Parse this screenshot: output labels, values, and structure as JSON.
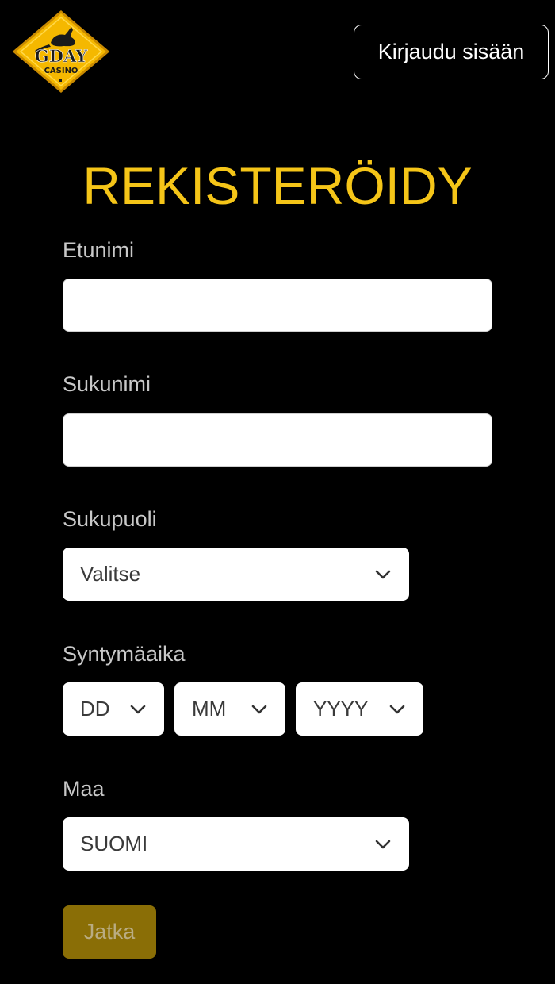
{
  "header": {
    "logo": {
      "text_main": "GDAY",
      "text_sub": "CASINO",
      "icon": "kangaroo-icon"
    },
    "login_label": "Kirjaudu sisään"
  },
  "form": {
    "title": "REKISTERÖIDY",
    "first_name": {
      "label": "Etunimi",
      "value": "",
      "placeholder": ""
    },
    "last_name": {
      "label": "Sukunimi",
      "value": "",
      "placeholder": ""
    },
    "gender": {
      "label": "Sukupuoli",
      "selected": "Valitse"
    },
    "birthdate": {
      "label": "Syntymäaika",
      "day": "DD",
      "month": "MM",
      "year": "YYYY"
    },
    "country": {
      "label": "Maa",
      "selected": "SUOMI"
    },
    "continue_label": "Jatka"
  },
  "colors": {
    "background": "#000000",
    "accent": "#f5c518",
    "button_disabled": "#8a6e06",
    "label": "#c8c8c8"
  }
}
